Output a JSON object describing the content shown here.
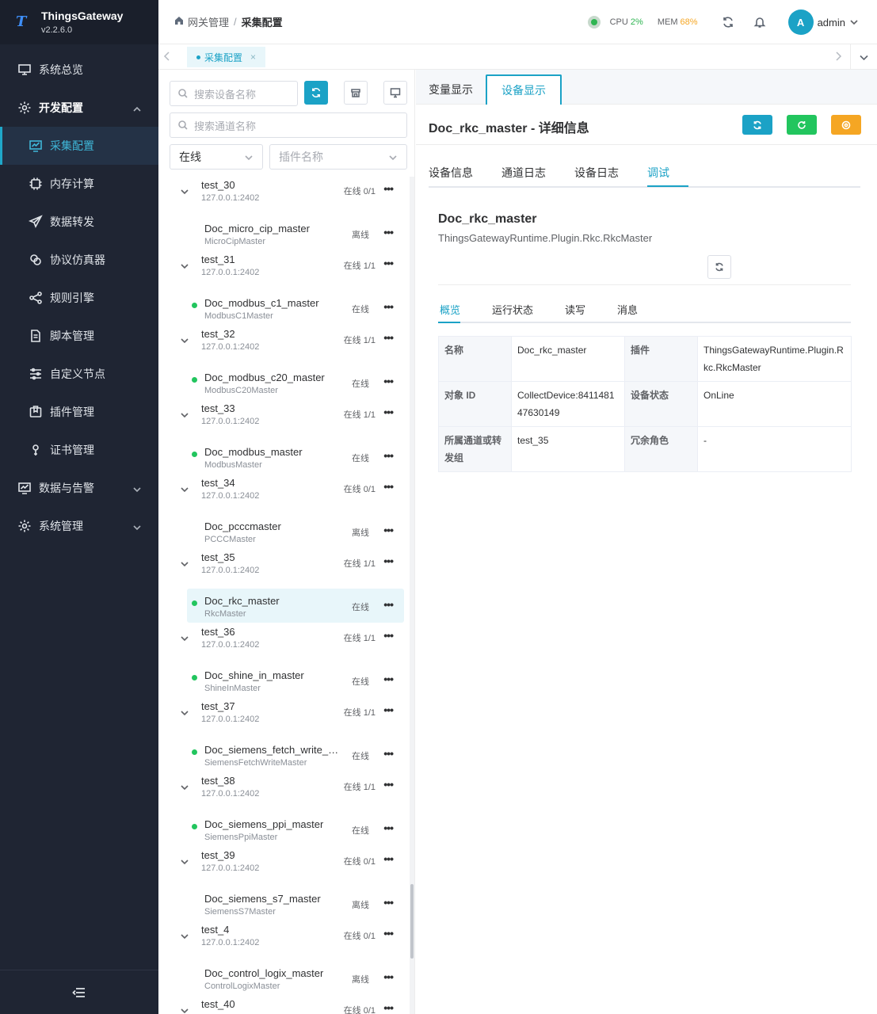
{
  "app": {
    "name": "ThingsGateway",
    "version": "v2.2.6.0"
  },
  "sidebar": {
    "items": [
      {
        "label": "系统总览",
        "icon": "monitor-icon",
        "level": "top"
      },
      {
        "label": "开发配置",
        "icon": "gear-icon",
        "level": "top",
        "expanded": true
      },
      {
        "label": "采集配置",
        "icon": "chart-monitor-icon",
        "level": "sub",
        "active": true
      },
      {
        "label": "内存计算",
        "icon": "chip-icon",
        "level": "sub"
      },
      {
        "label": "数据转发",
        "icon": "send-icon",
        "level": "sub"
      },
      {
        "label": "协议仿真器",
        "icon": "link-icon",
        "level": "sub"
      },
      {
        "label": "规则引擎",
        "icon": "share-icon",
        "level": "sub"
      },
      {
        "label": "脚本管理",
        "icon": "document-icon",
        "level": "sub"
      },
      {
        "label": "自定义节点",
        "icon": "sliders-icon",
        "level": "sub"
      },
      {
        "label": "插件管理",
        "icon": "package-icon",
        "level": "sub"
      },
      {
        "label": "证书管理",
        "icon": "certificate-icon",
        "level": "sub"
      },
      {
        "label": "数据与告警",
        "icon": "chart-monitor-icon",
        "level": "top"
      },
      {
        "label": "系统管理",
        "icon": "gear-icon",
        "level": "top"
      }
    ]
  },
  "header": {
    "breadcrumb": [
      "网关管理",
      "采集配置"
    ],
    "cpu_label": "CPU",
    "cpu_value": "2%",
    "mem_label": "MEM",
    "mem_value": "68%",
    "avatar_letter": "A",
    "user": "admin",
    "colors": {
      "cpu": "#2fb552",
      "mem": "#f5a623",
      "accent": "#1ba2c6"
    }
  },
  "tabs": {
    "page_tab": "采集配置",
    "close": "×"
  },
  "devices": {
    "search_device_placeholder": "搜索设备名称",
    "search_channel_placeholder": "搜索通道名称",
    "status_filter": "在线",
    "plugin_filter_placeholder": "插件名称",
    "tree": [
      {
        "channel": "test_30",
        "addr": "127.0.0.1:2402",
        "stat": "在线 0/1",
        "device": "Doc_micro_cip_master",
        "plugin": "MicroCipMaster",
        "dstat": "离线",
        "online": false
      },
      {
        "channel": "test_31",
        "addr": "127.0.0.1:2402",
        "stat": "在线 1/1",
        "device": "Doc_modbus_c1_master",
        "plugin": "ModbusC1Master",
        "dstat": "在线",
        "online": true
      },
      {
        "channel": "test_32",
        "addr": "127.0.0.1:2402",
        "stat": "在线 1/1",
        "device": "Doc_modbus_c20_master",
        "plugin": "ModbusC20Master",
        "dstat": "在线",
        "online": true
      },
      {
        "channel": "test_33",
        "addr": "127.0.0.1:2402",
        "stat": "在线 1/1",
        "device": "Doc_modbus_master",
        "plugin": "ModbusMaster",
        "dstat": "在线",
        "online": true
      },
      {
        "channel": "test_34",
        "addr": "127.0.0.1:2402",
        "stat": "在线 0/1",
        "device": "Doc_pcccmaster",
        "plugin": "PCCCMaster",
        "dstat": "离线",
        "online": false
      },
      {
        "channel": "test_35",
        "addr": "127.0.0.1:2402",
        "stat": "在线 1/1",
        "device": "Doc_rkc_master",
        "plugin": "RkcMaster",
        "dstat": "在线",
        "online": true,
        "selected": true
      },
      {
        "channel": "test_36",
        "addr": "127.0.0.1:2402",
        "stat": "在线 1/1",
        "device": "Doc_shine_in_master",
        "plugin": "ShineInMaster",
        "dstat": "在线",
        "online": true
      },
      {
        "channel": "test_37",
        "addr": "127.0.0.1:2402",
        "stat": "在线 1/1",
        "device": "Doc_siemens_fetch_write_master",
        "plugin": "SiemensFetchWriteMaster",
        "dstat": "在线",
        "online": true
      },
      {
        "channel": "test_38",
        "addr": "127.0.0.1:2402",
        "stat": "在线 1/1",
        "device": "Doc_siemens_ppi_master",
        "plugin": "SiemensPpiMaster",
        "dstat": "在线",
        "online": true
      },
      {
        "channel": "test_39",
        "addr": "127.0.0.1:2402",
        "stat": "在线 0/1",
        "device": "Doc_siemens_s7_master",
        "plugin": "SiemensS7Master",
        "dstat": "离线",
        "online": false
      },
      {
        "channel": "test_4",
        "addr": "127.0.0.1:2402",
        "stat": "在线 0/1",
        "device": "Doc_control_logix_master",
        "plugin": "ControlLogixMaster",
        "dstat": "离线",
        "online": false
      },
      {
        "channel": "test_40",
        "addr": "",
        "stat": "在线 0/1"
      }
    ]
  },
  "main": {
    "view_tabs": [
      "变量显示",
      "设备显示"
    ],
    "title": "Doc_rkc_master - 详细信息",
    "action_colors": [
      "#1ba2c6",
      "#22c55e",
      "#f5a623"
    ],
    "sub_tabs": [
      "设备信息",
      "通道日志",
      "设备日志",
      "调试"
    ],
    "device_name": "Doc_rkc_master",
    "device_plugin": "ThingsGatewayRuntime.Plugin.Rkc.RkcMaster",
    "inner_tabs": [
      "概览",
      "运行状态",
      "读写",
      "消息"
    ],
    "info": {
      "name_k": "名称",
      "name_v": "Doc_rkc_master",
      "plugin_k": "插件",
      "plugin_v": "ThingsGatewayRuntime.Plugin.Rkc.RkcMaster",
      "id_k": "对象 ID",
      "id_v": "CollectDevice:841148147630149",
      "state_k": "设备状态",
      "state_v": "OnLine",
      "channel_k": "所属通道或转发组",
      "channel_v": "test_35",
      "role_k": "冗余角色",
      "role_v": "-"
    }
  }
}
